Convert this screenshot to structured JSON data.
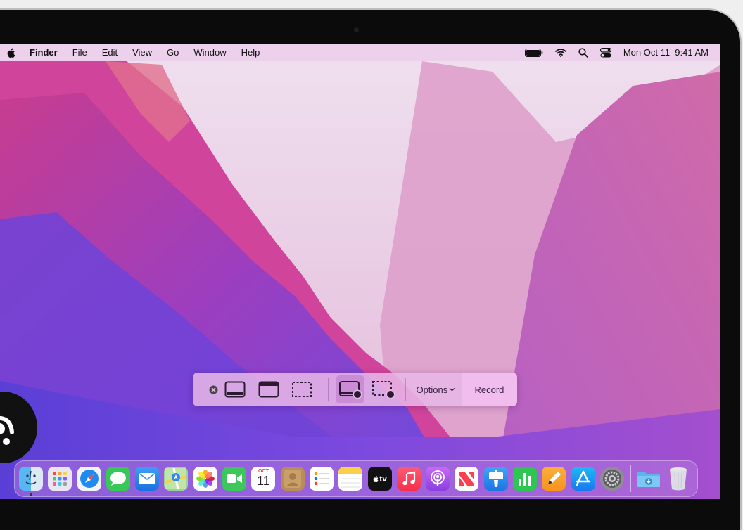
{
  "menubar": {
    "app_name": "Finder",
    "menus": [
      "File",
      "Edit",
      "View",
      "Go",
      "Window",
      "Help"
    ],
    "clock": "Mon Oct 11  9:41 AM"
  },
  "toolbar": {
    "options_label": "Options",
    "record_label": "Record"
  },
  "dock": {
    "calendar_month": "OCT",
    "calendar_day": "11",
    "tv_label": "tv"
  },
  "colors": {
    "wallpaper_base": "#b8459c",
    "toolbar_bg": "#e8b8e8",
    "dock_bg": "#b478dc"
  }
}
